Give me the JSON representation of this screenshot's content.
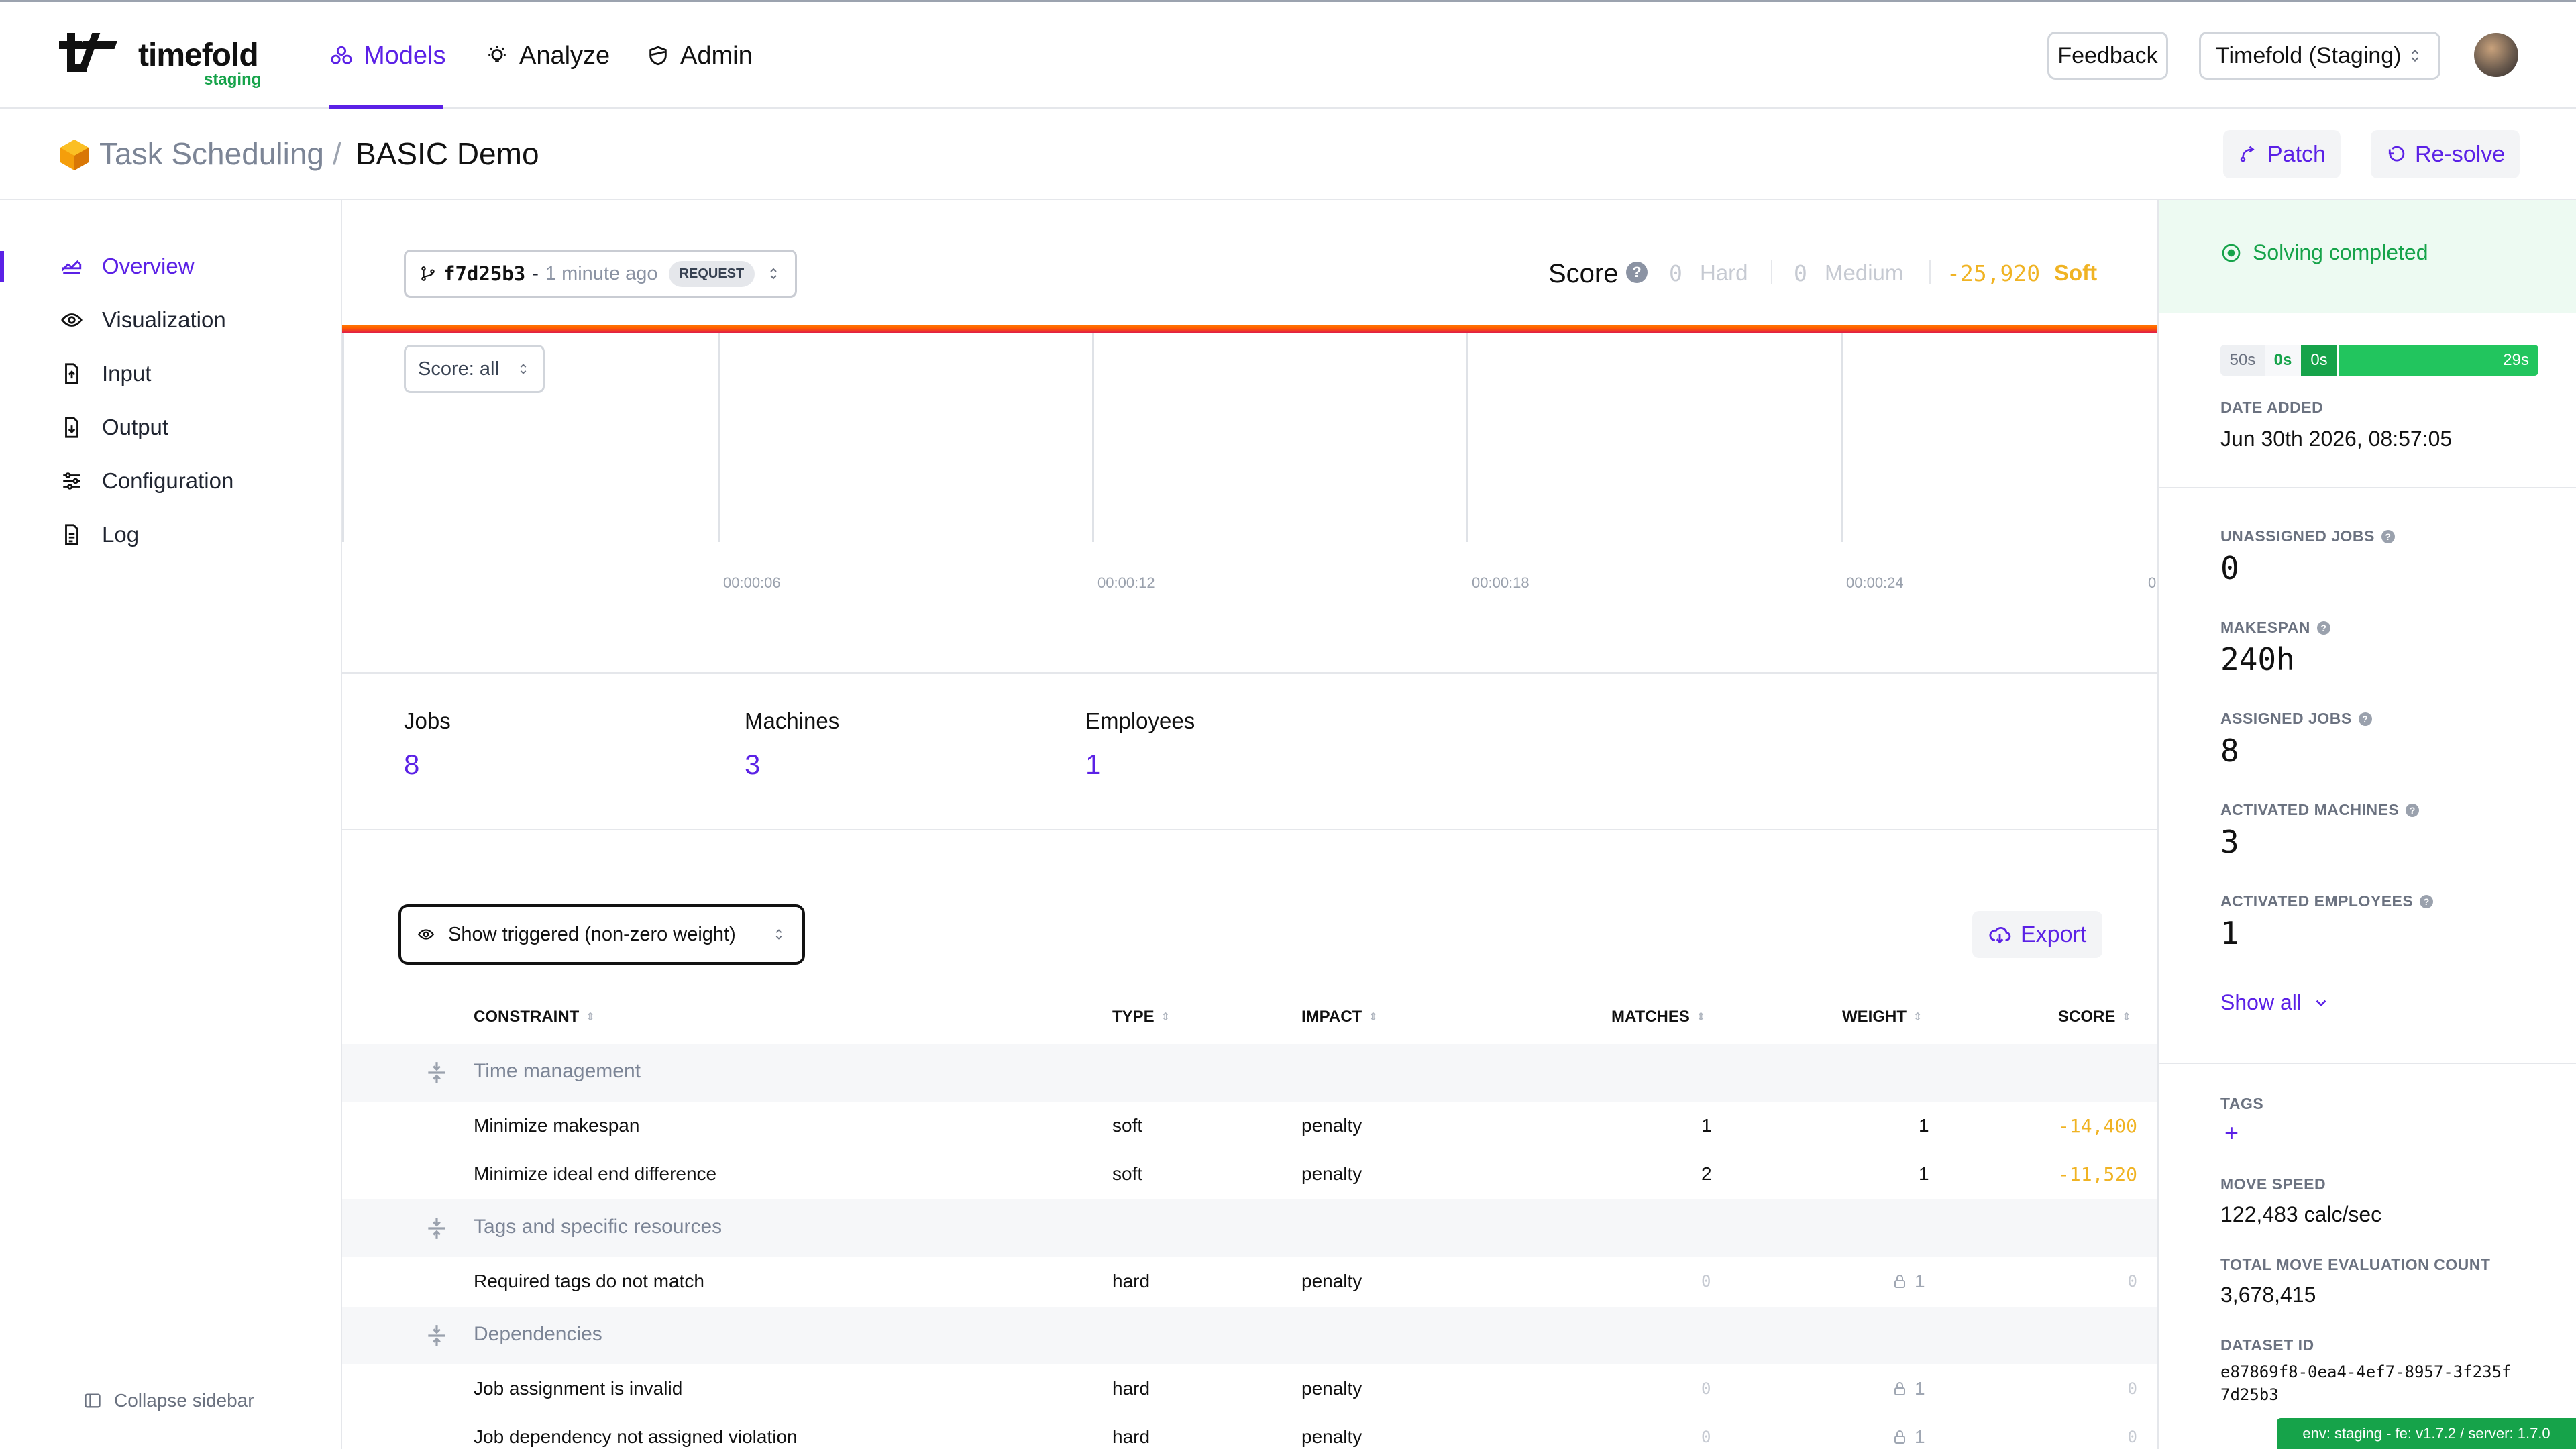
{
  "brand": {
    "name": "timefold",
    "env": "staging"
  },
  "nav": {
    "models": "Models",
    "analyze": "Analyze",
    "admin": "Admin"
  },
  "header": {
    "feedback": "Feedback",
    "org": "Timefold (Staging)"
  },
  "breadcrumb": {
    "parent": "Task Scheduling",
    "separator": "/",
    "current": "BASIC Demo"
  },
  "actions": {
    "patch": "Patch",
    "resolve": "Re-solve"
  },
  "sidebar": {
    "items": [
      {
        "label": "Overview",
        "icon": "chart-area-icon",
        "active": true
      },
      {
        "label": "Visualization",
        "icon": "eye-icon"
      },
      {
        "label": "Input",
        "icon": "file-upload-icon"
      },
      {
        "label": "Output",
        "icon": "file-download-icon"
      },
      {
        "label": "Configuration",
        "icon": "sliders-icon"
      },
      {
        "label": "Log",
        "icon": "file-text-icon"
      }
    ],
    "collapse": "Collapse sidebar"
  },
  "version": {
    "hash": "f7d25b3",
    "dash": "-",
    "time": "1 minute ago",
    "badge": "REQUEST"
  },
  "score": {
    "label": "Score",
    "help": "?",
    "hard_value": "0",
    "hard_label": "Hard",
    "medium_value": "0",
    "medium_label": "Medium",
    "soft_value": "-25,920",
    "soft_label": "Soft"
  },
  "chart": {
    "filter": "Score: all",
    "ticks": [
      "00:00:06",
      "00:00:12",
      "00:00:18",
      "00:00:24",
      "0"
    ]
  },
  "stats": [
    {
      "label": "Jobs",
      "value": "8"
    },
    {
      "label": "Machines",
      "value": "3"
    },
    {
      "label": "Employees",
      "value": "1"
    }
  ],
  "constraints": {
    "filter": "Show triggered (non-zero weight)",
    "export": "Export",
    "columns": [
      "CONSTRAINT",
      "TYPE",
      "IMPACT",
      "MATCHES",
      "WEIGHT",
      "SCORE"
    ],
    "groups": [
      {
        "name": "Time management",
        "rows": [
          {
            "name": "Minimize makespan",
            "type": "soft",
            "impact": "penalty",
            "matches": "1",
            "weight": "1",
            "score": "-14,400"
          },
          {
            "name": "Minimize ideal end difference",
            "type": "soft",
            "impact": "penalty",
            "matches": "2",
            "weight": "1",
            "score": "-11,520"
          }
        ]
      },
      {
        "name": "Tags and specific resources",
        "rows": [
          {
            "name": "Required tags do not match",
            "type": "hard",
            "impact": "penalty",
            "matches": "0",
            "weight": "1",
            "score": "0"
          }
        ]
      },
      {
        "name": "Dependencies",
        "rows": [
          {
            "name": "Job assignment is invalid",
            "type": "hard",
            "impact": "penalty",
            "matches": "0",
            "weight": "1",
            "score": "0"
          },
          {
            "name": "Job dependency not assigned violation",
            "type": "hard",
            "impact": "penalty",
            "matches": "0",
            "weight": "1",
            "score": "0"
          }
        ]
      }
    ]
  },
  "right": {
    "status": "Solving completed",
    "timeline": [
      "50s",
      "0s",
      "0s",
      "29s"
    ],
    "date_added_label": "DATE ADDED",
    "date_added": "Jun 30th 2026, 08:57:05",
    "kpis": [
      {
        "label": "UNASSIGNED JOBS",
        "value": "0"
      },
      {
        "label": "MAKESPAN",
        "value": "240h"
      },
      {
        "label": "ASSIGNED JOBS",
        "value": "8"
      },
      {
        "label": "ACTIVATED MACHINES",
        "value": "3"
      },
      {
        "label": "ACTIVATED EMPLOYEES",
        "value": "1"
      }
    ],
    "show_all": "Show all",
    "tags_label": "TAGS",
    "tags_add": "+",
    "move_speed_label": "MOVE SPEED",
    "move_speed": "122,483 calc/sec",
    "move_count_label": "TOTAL MOVE EVALUATION COUNT",
    "move_count": "3,678,415",
    "dataset_label": "DATASET ID",
    "dataset_id": "e87869f8-0ea4-4ef7-8957-3f235f7d25b3"
  },
  "env_badge": "env: staging - fe: v1.7.2 / server: 1.7.0",
  "colors": {
    "accent": "#5b21e6",
    "success": "#16a34a",
    "soft_score": "#f0b323"
  }
}
